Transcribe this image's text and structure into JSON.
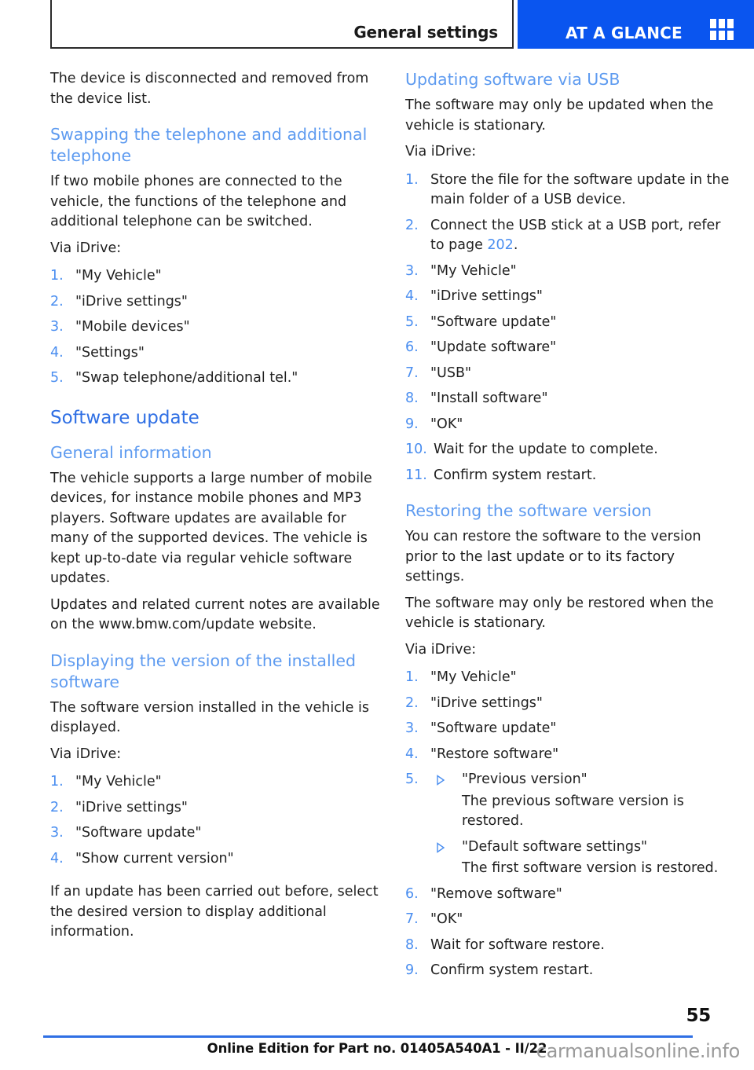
{
  "header": {
    "breadcrumb_title": "General settings",
    "tab_label": "AT A GLANCE",
    "tab_color": "#0a55ef",
    "icon": "grid-icon"
  },
  "colors": {
    "h1_blue": "#2f6fe4",
    "h2_blue": "#5e9bf0",
    "list_number_blue": "#4a8ef0",
    "tab_blue": "#0a55ef",
    "body_text": "#1f1f1f"
  },
  "left_column": {
    "intro_paragraph": "The device is disconnected and removed from the device list.",
    "section_swapping": {
      "heading": "Swapping the telephone and additional telephone",
      "paragraph": "If two mobile phones are connected to the vehicle, the functions of the telephone and additional telephone can be switched.",
      "via_label": "Via iDrive:",
      "steps": [
        {
          "num": "1.",
          "text": "\"My Vehicle\""
        },
        {
          "num": "2.",
          "text": "\"iDrive settings\""
        },
        {
          "num": "3.",
          "text": "\"Mobile devices\""
        },
        {
          "num": "4.",
          "text": "\"Settings\""
        },
        {
          "num": "5.",
          "text": "\"Swap telephone/additional tel.\""
        }
      ]
    },
    "section_software_update": {
      "heading": "Software update",
      "general_information": {
        "heading": "General information",
        "paragraph_1": "The vehicle supports a large number of mobile devices, for instance mobile phones and MP3 players. Software updates are available for many of the supported devices. The vehicle is kept up-to-date via regular vehicle software updates.",
        "paragraph_2": "Updates and related current notes are available on the www.bmw.com/update website."
      },
      "displaying_version": {
        "heading": "Displaying the version of the installed software",
        "paragraph": "The software version installed in the vehicle is displayed.",
        "via_label": "Via iDrive:",
        "steps": [
          {
            "num": "1.",
            "text": "\"My Vehicle\""
          },
          {
            "num": "2.",
            "text": "\"iDrive settings\""
          },
          {
            "num": "3.",
            "text": "\"Software update\""
          },
          {
            "num": "4.",
            "text": "\"Show current version\""
          }
        ],
        "closing_paragraph": "If an update has been carried out before, select the desired version to display additional information."
      }
    }
  },
  "right_column": {
    "section_usb": {
      "heading": "Updating software via USB",
      "paragraph": "The software may only be updated when the vehicle is stationary.",
      "via_label": "Via iDrive:",
      "steps": [
        {
          "num": "1.",
          "text": "Store the file for the software update in the main folder of a USB device."
        },
        {
          "num": "2.",
          "text_before": "Connect the USB stick at a USB port, refer to page ",
          "page_ref": "202",
          "text_after": "."
        },
        {
          "num": "3.",
          "text": "\"My Vehicle\""
        },
        {
          "num": "4.",
          "text": "\"iDrive settings\""
        },
        {
          "num": "5.",
          "text": "\"Software update\""
        },
        {
          "num": "6.",
          "text": "\"Update software\""
        },
        {
          "num": "7.",
          "text": "\"USB\""
        },
        {
          "num": "8.",
          "text": "\"Install software\""
        },
        {
          "num": "9.",
          "text": "\"OK\""
        },
        {
          "num": "10.",
          "text": "Wait for the update to complete."
        },
        {
          "num": "11.",
          "text": "Confirm system restart."
        }
      ]
    },
    "section_restoring": {
      "heading": "Restoring the software version",
      "paragraph_1": "You can restore the software to the version prior to the last update or to its factory settings.",
      "paragraph_2": "The software may only be restored when the vehicle is stationary.",
      "via_label": "Via iDrive:",
      "steps_part1": [
        {
          "num": "1.",
          "text": "\"My Vehicle\""
        },
        {
          "num": "2.",
          "text": "\"iDrive settings\""
        },
        {
          "num": "3.",
          "text": "\"Software update\""
        },
        {
          "num": "4.",
          "text": "\"Restore software\""
        }
      ],
      "step5": {
        "num": "5.",
        "options": [
          {
            "marker": "triangle-right-icon",
            "label": "\"Previous version\"",
            "note": "The previous software version is restored."
          },
          {
            "marker": "triangle-right-icon",
            "label": "\"Default software settings\"",
            "note": "The first software version is restored."
          }
        ]
      },
      "steps_part2": [
        {
          "num": "6.",
          "text": "\"Remove software\""
        },
        {
          "num": "7.",
          "text": "\"OK\""
        },
        {
          "num": "8.",
          "text": "Wait for software restore."
        },
        {
          "num": "9.",
          "text": "Confirm system restart."
        }
      ]
    }
  },
  "footer": {
    "page_number": "55",
    "edition_text": "Online Edition for Part no. 01405A540A1 - II/22",
    "watermark": "carmanualsonline.info"
  }
}
